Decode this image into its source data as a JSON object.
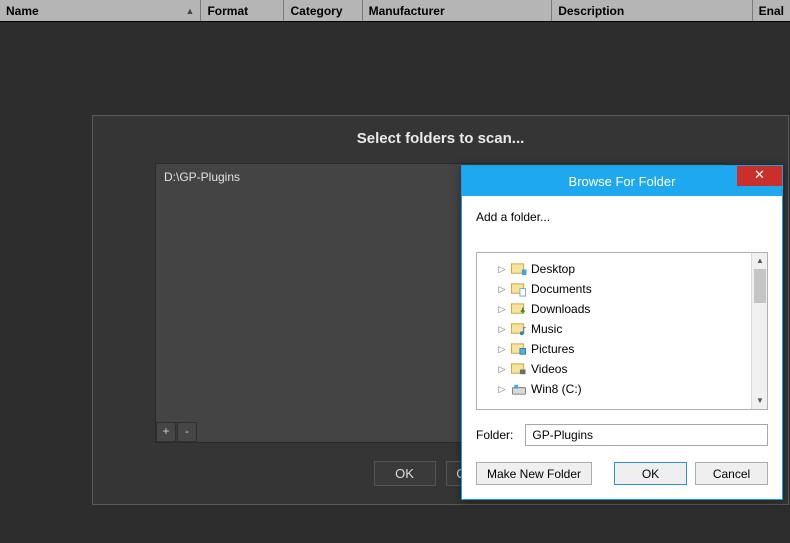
{
  "table": {
    "headers": {
      "name": "Name",
      "format": "Format",
      "category": "Category",
      "manufacturer": "Manufacturer",
      "description": "Description",
      "enable": "Enal"
    }
  },
  "folders_modal": {
    "title": "Select folders to scan...",
    "items": [
      "D:\\GP-Plugins"
    ],
    "add_label": "+",
    "remove_label": "-",
    "ok_label": "OK",
    "cancel_label": "Cancel"
  },
  "browse": {
    "title": "Browse For Folder",
    "instruction": "Add a folder...",
    "tree": [
      {
        "label": "Desktop",
        "icon": "desktop"
      },
      {
        "label": "Documents",
        "icon": "documents"
      },
      {
        "label": "Downloads",
        "icon": "downloads"
      },
      {
        "label": "Music",
        "icon": "music"
      },
      {
        "label": "Pictures",
        "icon": "pictures"
      },
      {
        "label": "Videos",
        "icon": "videos"
      },
      {
        "label": "Win8 (C:)",
        "icon": "drive"
      }
    ],
    "folder_label": "Folder:",
    "folder_value": "GP-Plugins",
    "make_label": "Make New Folder",
    "ok_label": "OK",
    "cancel_label": "Cancel",
    "close_glyph": "✕"
  }
}
